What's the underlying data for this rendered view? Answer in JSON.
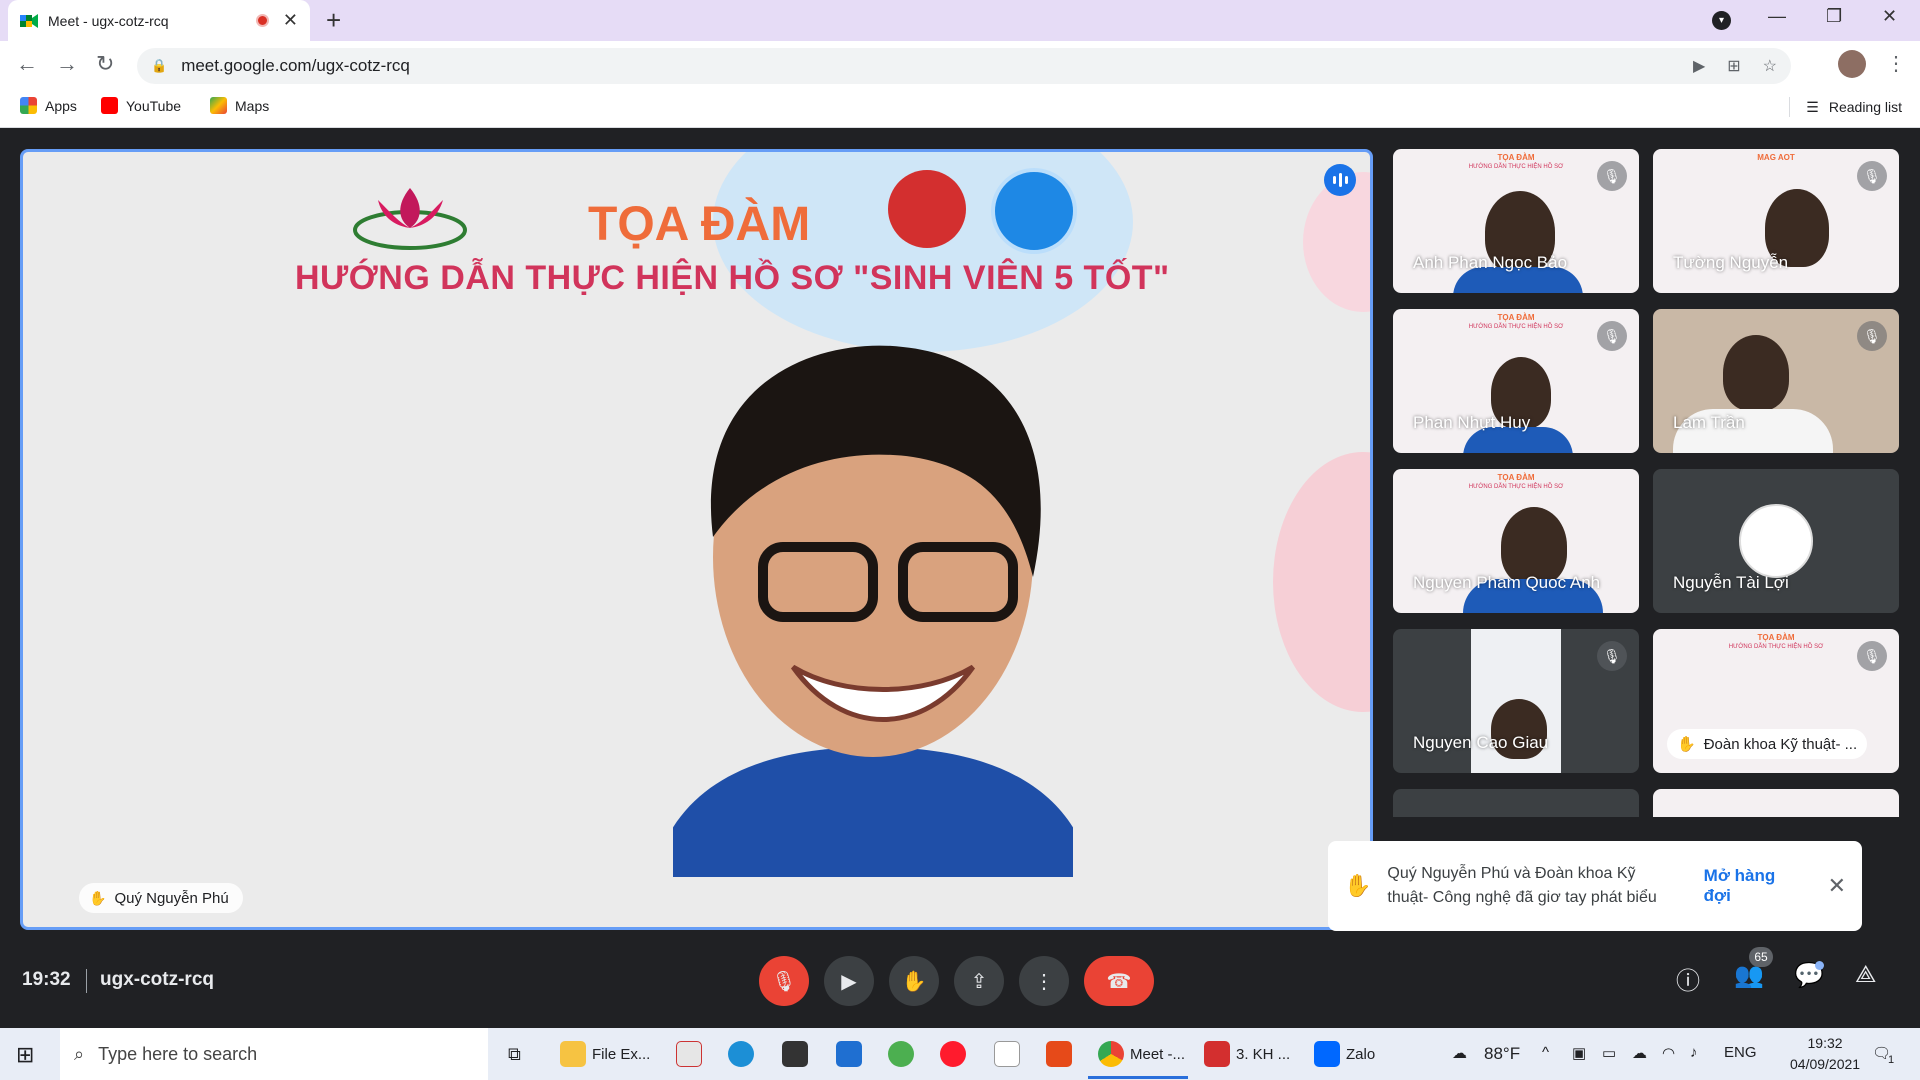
{
  "browser": {
    "tab_title": "Meet - ugx-cotz-rcq",
    "url": "meet.google.com/ugx-cotz-rcq",
    "bookmarks": [
      "Apps",
      "YouTube",
      "Maps"
    ],
    "reading_list": "Reading list"
  },
  "banner": {
    "title": "TỌA ĐÀM",
    "subtitle": "HƯỚNG DẪN THỰC HIỆN HỒ SƠ \"SINH VIÊN 5 TỐT\""
  },
  "main_tile": {
    "name": "Quý Nguyễn Phú"
  },
  "participants": [
    {
      "name": "Anh Phan Ngọc Bảo",
      "muted": true
    },
    {
      "name": "Tường Nguyễn",
      "muted": true
    },
    {
      "name": "Phan Nhựt Huy",
      "muted": true
    },
    {
      "name": "Lam Trần",
      "muted": true
    },
    {
      "name": "Nguyen Pham Quoc Anh",
      "muted": false
    },
    {
      "name": "Nguyễn Tài Lợi",
      "muted": false
    },
    {
      "name": "Nguyen Cao Giau",
      "muted": true
    },
    {
      "name": "Đoàn khoa Kỹ thuật- ...",
      "muted": true,
      "hand_raised": true
    }
  ],
  "toast": {
    "message": "Quý Nguyễn Phú và Đoàn khoa Kỹ thuật- Công nghệ đã giơ tay phát biểu",
    "action": "Mở hàng đợi"
  },
  "bottom_bar": {
    "time": "19:32",
    "meeting_code": "ugx-cotz-rcq",
    "people_count": "65"
  },
  "taskbar": {
    "search_placeholder": "Type here to search",
    "apps": [
      "File Ex...",
      "Meet -...",
      "3. KH ...",
      "Zalo"
    ],
    "weather": "88°F",
    "language": "ENG",
    "clock_time": "19:32",
    "clock_date": "04/09/2021",
    "notifications": "1"
  }
}
